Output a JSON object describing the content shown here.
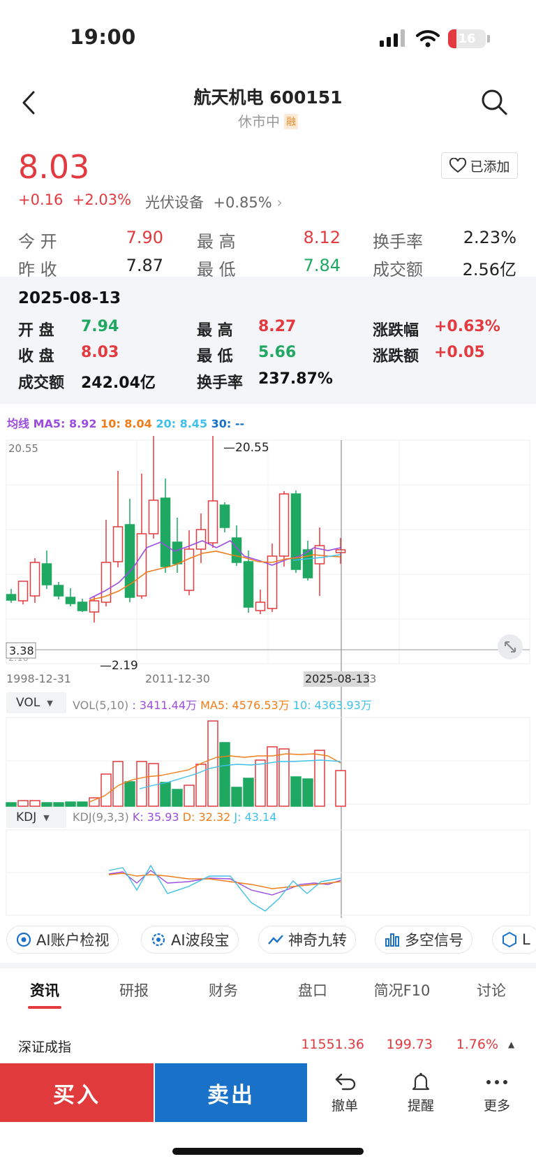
{
  "status": {
    "time": "19:00",
    "battery": "16"
  },
  "header": {
    "name": "航天机电",
    "code": "600151",
    "state": "休市中",
    "badge": "融"
  },
  "quote": {
    "price": "8.03",
    "change": "+0.16",
    "change_pct": "+2.03%",
    "sector": "光伏设备",
    "sector_pct": "+0.85%",
    "add_label": "已添加",
    "rows": [
      {
        "l1": "今 开",
        "v1": "7.90",
        "l2": "最 高",
        "v2": "8.12",
        "l3": "换手率",
        "v3": "2.23%"
      },
      {
        "l1": "昨 收",
        "v1": "7.87",
        "l2": "最 低",
        "v2": "7.84",
        "l3": "成交额",
        "v3": "2.56亿"
      }
    ]
  },
  "panel": {
    "date": "2025-08-13",
    "open_lbl": "开 盘",
    "open": "7.94",
    "close_lbl": "收 盘",
    "close": "8.03",
    "amt_lbl": "成交额",
    "amt": "242.04亿",
    "high_lbl": "最 高",
    "high": "8.27",
    "low_lbl": "最 低",
    "low": "5.66",
    "turn_lbl": "换手率",
    "turn": "237.87%",
    "pct_lbl": "涨跌幅",
    "pct": "+0.63%",
    "chg_lbl": "涨跌额",
    "chg": "+0.05"
  },
  "ma": {
    "title": "均线",
    "ma5": "MA5: 8.92",
    "ma10": "10: 8.04",
    "ma20": "20: 8.45",
    "ma30": "30: --"
  },
  "kline": {
    "top_label": "20.55",
    "max_label": "20.55",
    "min_label": "2.19",
    "cur_label": "3.38",
    "bottom_label": "2.10",
    "dates": [
      "1998-12-31",
      "2011-12-30",
      "2025-08-13",
      "13"
    ]
  },
  "vol": {
    "btn": "VOL",
    "legend": "VOL(5,10)",
    "vol": ": 3411.44万",
    "ma5": "MA5: 4576.53万",
    "ma10": "10: 4363.93万"
  },
  "kdj": {
    "btn": "KDJ",
    "legend": "KDJ(9,3,3)",
    "k": "K: 35.93",
    "d": "D: 32.32",
    "j": "J: 43.14"
  },
  "chips": [
    "AI账户检视",
    "AI波段宝",
    "神奇九转",
    "多空信号",
    "L"
  ],
  "tabs": [
    "资讯",
    "研报",
    "财务",
    "盘口",
    "简况F10",
    "讨论"
  ],
  "index_row": {
    "name": "深证成指",
    "value": "11551.36",
    "change": "199.73",
    "pct": "1.76%"
  },
  "actions": {
    "buy": "买入",
    "sell": "卖出",
    "cancel": "撤单",
    "alert": "提醒",
    "more": "更多"
  },
  "colors": {
    "up": "#e23a3f",
    "down": "#1ea861",
    "ma5": "#9b4de0",
    "ma10": "#f07d1a",
    "ma20": "#3fc0e8",
    "ma30": "#1a72c8"
  }
}
